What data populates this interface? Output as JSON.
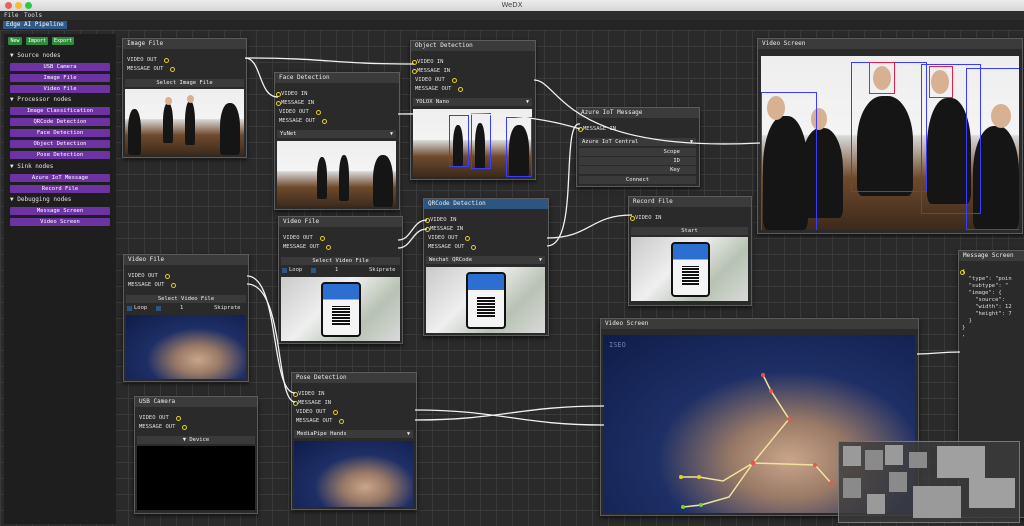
{
  "window": {
    "title": "WeDX"
  },
  "menu": {
    "file": "File",
    "tools": "Tools"
  },
  "tab": {
    "label": "Edge AI Pipeline"
  },
  "toolbar": {
    "new": "New",
    "import": "Import",
    "export": "Export"
  },
  "sidebar": {
    "source_head": "Source nodes",
    "source_items": [
      "USB Camera",
      "Image File",
      "Video File"
    ],
    "processor_head": "Processor nodes",
    "processor_items": [
      "Image Classification",
      "QRCode Detection",
      "Face Detection",
      "Object Detection",
      "Pose Detection"
    ],
    "sink_head": "Sink nodes",
    "sink_items": [
      "Azure IoT Message",
      "Record File"
    ],
    "debug_head": "Debugging nodes",
    "debug_items": [
      "Message Screen",
      "Video Screen"
    ]
  },
  "pins": {
    "video_in": "VIDEO IN",
    "message_in": "MESSAGE IN",
    "video_out": "VIDEO OUT",
    "message_out": "MESSAGE OUT"
  },
  "nodes": {
    "image_file": {
      "title": "Image File",
      "button": "Select Image File"
    },
    "object_detection": {
      "title": "Object Detection",
      "model": "YOLOX Nano"
    },
    "face_detection": {
      "title": "Face Detection",
      "model": "YuNet"
    },
    "azure_iot": {
      "title": "Azure IoT Message",
      "option": "Azure IoT Central",
      "fields": [
        "Scope",
        "ID",
        "Key"
      ],
      "button": "Connect"
    },
    "video_screen_1": {
      "title": "Video Screen"
    },
    "video_file_1": {
      "title": "Video File",
      "button": "Select Video File",
      "loop": "Loop",
      "skip_value": "1",
      "skip_label": "Skiprate"
    },
    "qrcode_detection": {
      "title": "QRCode Detection",
      "model": "Wechat QRCode"
    },
    "record_file": {
      "title": "Record File",
      "button": "Start"
    },
    "message_screen": {
      "title": "Message Screen",
      "json": "{\n  \"type\": \"poin\n  \"subtype\": \"\n  \"image\": {\n    \"source\":\n    \"width\": 12\n    \"height\": 7\n  }\n}\n,"
    },
    "video_file_2": {
      "title": "Video File",
      "button": "Select Video File",
      "loop": "Loop",
      "skip_value": "1",
      "skip_label": "Skiprate"
    },
    "usb_camera": {
      "title": "USB Camera",
      "device": "Device"
    },
    "pose_detection": {
      "title": "Pose Detection",
      "model": "MediaPipe Hands"
    },
    "video_screen_2": {
      "title": "Video Screen",
      "watermark": "ISEO"
    }
  }
}
